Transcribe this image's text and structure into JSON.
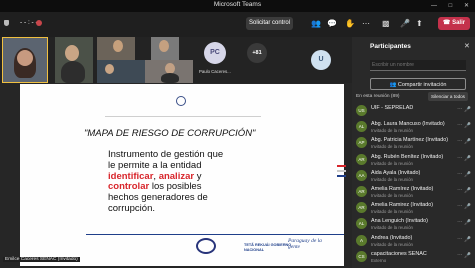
{
  "window": {
    "title": "Microsoft Teams"
  },
  "toolbar": {
    "timer": "- - : - -",
    "request_control": "Solicitar control",
    "leave": "Salir",
    "leave_color": "#c4314b"
  },
  "gallery": {
    "avatar_pc": "PC",
    "avatar_pc_name": "Paulo Caceres...",
    "overflow": "+81",
    "avatar_u": "U"
  },
  "share": {
    "presenter": "Emilce Caceres SENAC (Invitado)",
    "slide": {
      "title": "\"MAPA DE RIESGO DE CORRUPCIÓN\"",
      "line1": "Instrumento de gestión que",
      "line2": "le permite a la entidad",
      "w_identificar": "identificar",
      "comma1": ",",
      "w_analizar": "analizar",
      "w_y": " y",
      "w_controlar": "controlar",
      "line3b": " los posibles",
      "line4": "hechos generadores de",
      "line5": "corrupción.",
      "footer_left": "TETÃ REKUÁI GOBIERNO NACIONAL",
      "footer_right": "Paraguay de la gente"
    }
  },
  "panel": {
    "title": "Participantes",
    "search_placeholder": "Escribir un nombre",
    "share_invite": "Compartir invitación",
    "in_meeting": "En esta reunión (89)",
    "mute_all": "Silenciar a todos",
    "participants": [
      {
        "initials": "US",
        "name": "UIF - SEPRELAD",
        "sub": ""
      },
      {
        "initials": "AL",
        "name": "Abg. Laura Mancuso (Invitado)",
        "sub": "Invitado de la reunión"
      },
      {
        "initials": "AP",
        "name": "Abg. Patricia Martínez (Invitado)",
        "sub": "Invitado de la reunión"
      },
      {
        "initials": "AR",
        "name": "Abg. Rubén Benítez (Invitado)",
        "sub": "Invitado de la reunión"
      },
      {
        "initials": "AA",
        "name": "Aida Ayala (Invitado)",
        "sub": "Invitado de la reunión"
      },
      {
        "initials": "AR",
        "name": "Amelia Ramírez (Invitado)",
        "sub": "Invitado de la reunión"
      },
      {
        "initials": "AR",
        "name": "Amelia Ramirez (Invitado)",
        "sub": "Invitado de la reunión"
      },
      {
        "initials": "AL",
        "name": "Ana Lenguich (Invitado)",
        "sub": "Invitado de la reunión"
      },
      {
        "initials": "A",
        "name": "Andrea (Invitado)",
        "sub": "Invitado de la reunión"
      },
      {
        "initials": "CS",
        "name": "capacitaciones SENAC",
        "sub": "Externo"
      }
    ]
  }
}
